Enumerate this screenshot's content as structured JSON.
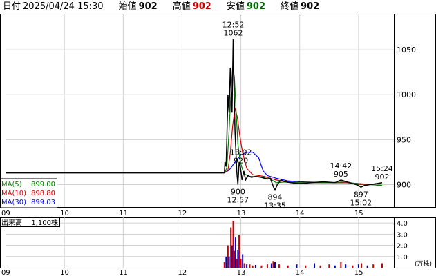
{
  "header": {
    "date_label": "日付",
    "datetime": "2025/04/24 15:30",
    "open_label": "始値",
    "open": "902",
    "high_label": "高値",
    "high": "902",
    "low_label": "安値",
    "low": "902",
    "close_label": "終値",
    "close": "902"
  },
  "colors": {
    "price": "#000000",
    "ma5": "#008000",
    "ma10": "#cc0000",
    "ma30": "#0000ff",
    "grid": "#d0d0d0",
    "high_value": "#cc0000",
    "low_value": "#006600",
    "vol_up": "#cc0000",
    "vol_down": "#0000cc"
  },
  "chart_data": {
    "type": "line",
    "title": "",
    "x_ticks": [
      "09",
      "10",
      "11",
      "12",
      "13",
      "14",
      "15"
    ],
    "y_ticks": [
      900,
      950,
      1000,
      1050
    ],
    "ylim": [
      875,
      1090
    ],
    "grid": true,
    "legend": [
      {
        "name": "MA(5)",
        "value": "899.00",
        "color": "#008000"
      },
      {
        "name": "MA(10)",
        "value": "898.80",
        "color": "#cc0000"
      },
      {
        "name": "MA(30)",
        "value": "899.03",
        "color": "#0000ff"
      }
    ],
    "price_series": [
      [
        9.0,
        913
      ],
      [
        12.72,
        913
      ],
      [
        12.73,
        925
      ],
      [
        12.75,
        920
      ],
      [
        12.78,
        1000
      ],
      [
        12.8,
        980
      ],
      [
        12.82,
        1030
      ],
      [
        12.85,
        980
      ],
      [
        12.87,
        1062
      ],
      [
        12.88,
        1020
      ],
      [
        12.9,
        960
      ],
      [
        12.92,
        930
      ],
      [
        12.93,
        915
      ],
      [
        12.95,
        900
      ],
      [
        12.97,
        925
      ],
      [
        12.99,
        920
      ],
      [
        13.02,
        905
      ],
      [
        13.05,
        915
      ],
      [
        13.08,
        905
      ],
      [
        13.12,
        910
      ],
      [
        13.18,
        908
      ],
      [
        13.25,
        909
      ],
      [
        13.35,
        908
      ],
      [
        13.45,
        906
      ],
      [
        13.5,
        907
      ],
      [
        13.55,
        898
      ],
      [
        13.58,
        894
      ],
      [
        13.62,
        900
      ],
      [
        13.68,
        905
      ],
      [
        13.75,
        903
      ],
      [
        13.85,
        902
      ],
      [
        14.0,
        901
      ],
      [
        14.2,
        902
      ],
      [
        14.4,
        903
      ],
      [
        14.6,
        902
      ],
      [
        14.7,
        905
      ],
      [
        14.85,
        902
      ],
      [
        15.0,
        899
      ],
      [
        15.04,
        897
      ],
      [
        15.1,
        899
      ],
      [
        15.2,
        900
      ],
      [
        15.3,
        901
      ],
      [
        15.4,
        902
      ]
    ],
    "ma5_series": [
      [
        9.0,
        913
      ],
      [
        12.72,
        913
      ],
      [
        12.76,
        918
      ],
      [
        12.8,
        960
      ],
      [
        12.83,
        1000
      ],
      [
        12.86,
        1030
      ],
      [
        12.89,
        1020
      ],
      [
        12.92,
        980
      ],
      [
        12.95,
        945
      ],
      [
        12.99,
        925
      ],
      [
        13.05,
        912
      ],
      [
        13.15,
        909
      ],
      [
        13.3,
        909
      ],
      [
        13.5,
        906
      ],
      [
        13.6,
        902
      ],
      [
        13.8,
        903
      ],
      [
        14.0,
        902
      ],
      [
        14.5,
        902
      ],
      [
        14.8,
        903
      ],
      [
        15.0,
        900
      ],
      [
        15.2,
        900
      ],
      [
        15.4,
        899
      ]
    ],
    "ma10_series": [
      [
        9.0,
        913
      ],
      [
        12.72,
        913
      ],
      [
        12.78,
        916
      ],
      [
        12.82,
        935
      ],
      [
        12.86,
        965
      ],
      [
        12.9,
        985
      ],
      [
        12.94,
        975
      ],
      [
        12.98,
        955
      ],
      [
        13.03,
        935
      ],
      [
        13.1,
        918
      ],
      [
        13.2,
        911
      ],
      [
        13.4,
        909
      ],
      [
        13.6,
        905
      ],
      [
        13.8,
        903
      ],
      [
        14.0,
        902
      ],
      [
        14.5,
        902
      ],
      [
        14.8,
        902
      ],
      [
        15.0,
        901
      ],
      [
        15.2,
        900
      ],
      [
        15.4,
        899
      ]
    ],
    "ma30_series": [
      [
        9.0,
        913
      ],
      [
        12.72,
        913
      ],
      [
        12.8,
        916
      ],
      [
        12.9,
        925
      ],
      [
        13.0,
        933
      ],
      [
        13.1,
        936
      ],
      [
        13.2,
        936
      ],
      [
        13.3,
        930
      ],
      [
        13.38,
        915
      ],
      [
        13.45,
        910
      ],
      [
        13.6,
        907
      ],
      [
        13.8,
        904
      ],
      [
        14.0,
        903
      ],
      [
        14.5,
        902
      ],
      [
        14.8,
        902
      ],
      [
        15.0,
        901
      ],
      [
        15.2,
        900
      ],
      [
        15.4,
        899
      ]
    ],
    "annotations": [
      {
        "time": "12:52",
        "value": "1062",
        "x": 12.87,
        "y": 1062,
        "position": "above"
      },
      {
        "time": "13:02",
        "value": "920",
        "x": 13.0,
        "y": 920,
        "position": "above"
      },
      {
        "time": "12:57",
        "value": "900",
        "x": 12.95,
        "y": 900,
        "position": "below"
      },
      {
        "time": "13:35",
        "value": "894",
        "x": 13.58,
        "y": 894,
        "position": "below"
      },
      {
        "time": "14:42",
        "value": "905",
        "x": 14.7,
        "y": 905,
        "position": "above"
      },
      {
        "time": "15:02",
        "value": "897",
        "x": 15.04,
        "y": 897,
        "position": "below"
      },
      {
        "time": "15:24",
        "value": "902",
        "x": 15.4,
        "y": 902,
        "position": "above"
      }
    ],
    "volume": {
      "label": "出来高",
      "value": "1,100株",
      "unit": "(万株)",
      "y_ticks": [
        "1.0",
        "2.0",
        "3.0",
        "4.0"
      ],
      "ylim": [
        0,
        4.5
      ],
      "bars": [
        [
          12.72,
          0.5,
          "up"
        ],
        [
          12.75,
          1.0,
          "down"
        ],
        [
          12.78,
          2.0,
          "up"
        ],
        [
          12.8,
          1.0,
          "down"
        ],
        [
          12.83,
          3.6,
          "up"
        ],
        [
          12.85,
          2.0,
          "down"
        ],
        [
          12.87,
          4.2,
          "up"
        ],
        [
          12.89,
          1.5,
          "up"
        ],
        [
          12.91,
          2.7,
          "down"
        ],
        [
          12.93,
          0.8,
          "up"
        ],
        [
          12.95,
          1.6,
          "down"
        ],
        [
          12.97,
          2.9,
          "up"
        ],
        [
          13.0,
          0.8,
          "up"
        ],
        [
          13.03,
          1.2,
          "down"
        ],
        [
          13.06,
          0.4,
          "up"
        ],
        [
          13.1,
          0.3,
          "down"
        ],
        [
          13.15,
          0.3,
          "up"
        ],
        [
          13.2,
          0.2,
          "up"
        ],
        [
          13.25,
          0.25,
          "down"
        ],
        [
          13.35,
          0.2,
          "up"
        ],
        [
          13.45,
          0.3,
          "up"
        ],
        [
          13.52,
          0.4,
          "down"
        ],
        [
          13.55,
          0.6,
          "up"
        ],
        [
          13.58,
          0.5,
          "down"
        ],
        [
          13.65,
          0.3,
          "up"
        ],
        [
          13.8,
          0.2,
          "up"
        ],
        [
          13.95,
          0.3,
          "down"
        ],
        [
          14.1,
          0.2,
          "up"
        ],
        [
          14.25,
          0.4,
          "down"
        ],
        [
          14.35,
          0.2,
          "up"
        ],
        [
          14.5,
          0.3,
          "up"
        ],
        [
          14.6,
          0.2,
          "down"
        ],
        [
          14.7,
          0.5,
          "up"
        ],
        [
          14.78,
          0.3,
          "down"
        ],
        [
          14.9,
          0.2,
          "up"
        ],
        [
          15.0,
          0.3,
          "down"
        ],
        [
          15.05,
          0.4,
          "up"
        ],
        [
          15.15,
          0.2,
          "down"
        ],
        [
          15.25,
          0.3,
          "up"
        ],
        [
          15.4,
          0.4,
          "up"
        ]
      ]
    }
  }
}
